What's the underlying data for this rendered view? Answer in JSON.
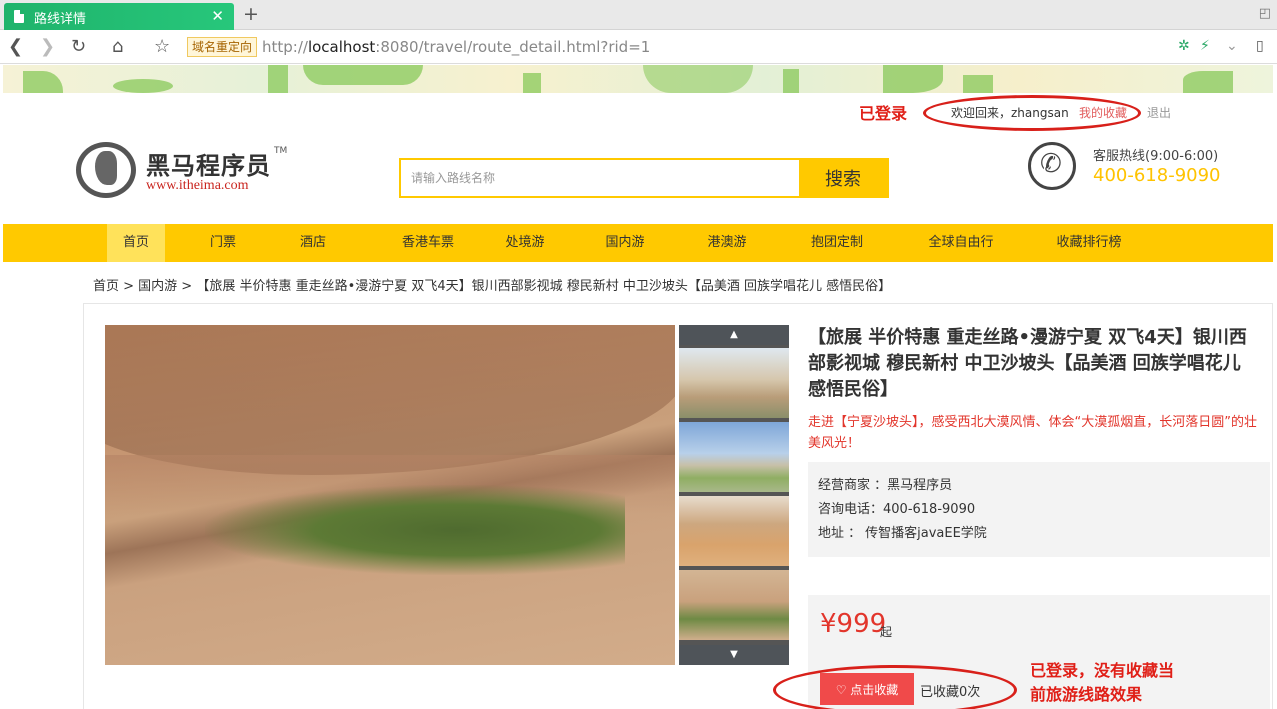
{
  "browser": {
    "tab_title": "路线详情",
    "tab_close": "✕",
    "new_tab": "+",
    "redirect_tag": "域名重定向",
    "url_prefix": "http://",
    "url_host": "localhost",
    "url_rest": ":8080/travel/route_detail.html?rid=1"
  },
  "header": {
    "welcome": "欢迎回来，zhangsan",
    "my_favorites": "我的收藏",
    "logout": "退出",
    "logo_name": "黑马程序员",
    "logo_tm": "TM",
    "logo_url": "www.itheima.com",
    "search_placeholder": "请输入路线名称",
    "search_button": "搜索",
    "hotline_label": "客服热线(9:00-6:00)",
    "hotline_number": "400-618-9090"
  },
  "nav": {
    "items": [
      "首页",
      "门票",
      "酒店",
      "香港车票",
      "处境游",
      "国内游",
      "港澳游",
      "抱团定制",
      "全球自由行",
      "收藏排行榜"
    ]
  },
  "breadcrumb": "首页 > 国内游 > 【旅展 半价特惠 重走丝路•漫游宁夏 双飞4天】银川西部影视城 穆民新村 中卫沙坡头【品美酒 回族学唱花儿 感悟民俗】",
  "route": {
    "title": "【旅展 半价特惠 重走丝路•漫游宁夏 双飞4天】银川西部影视城 穆民新村 中卫沙坡头【品美酒 回族学唱花儿 感悟民俗】",
    "description": "走进【宁夏沙坡头】，感受西北大漠风情、体会“大漠孤烟直，长河落日圆”的壮美风光！",
    "seller_label": "经营商家 ：",
    "seller": "黑马程序员",
    "phone_label": "咨询电话：",
    "phone": "400-618-9090",
    "address_label": "地址 ：",
    "address": "传智播客javaEE学院",
    "price": "¥999",
    "price_unit": "起",
    "favorite_button": "点击收藏",
    "favorite_count": "已收藏0次"
  },
  "annotations": {
    "logged_in": "已登录",
    "not_favorited_line1": "已登录，没有收藏当",
    "not_favorited_line2": "前旅游线路效果"
  },
  "colors": {
    "accent_yellow": "#ffc900",
    "price_red": "#e2352b",
    "annotation_red": "#d8201a",
    "tab_green": "#1fb36b"
  }
}
